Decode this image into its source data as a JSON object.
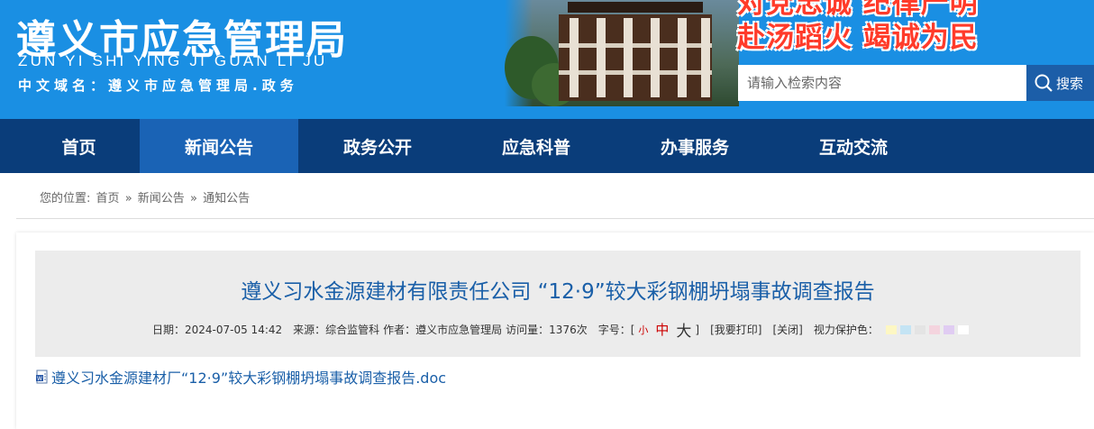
{
  "header": {
    "title": "遵义市应急管理局",
    "pinyin": "ZUN YI SHI YING JI GUAN LI JU",
    "domain": "中文域名：遵义市应急管理局.政务",
    "slogan_line1": "对党忠诚 纪律严明",
    "slogan_line2": "赴汤蹈火 竭诚为民"
  },
  "search": {
    "placeholder": "请输入检索内容",
    "button_label": "搜索"
  },
  "nav": {
    "items": [
      {
        "label": "首页"
      },
      {
        "label": "新闻公告"
      },
      {
        "label": "政务公开"
      },
      {
        "label": "应急科普"
      },
      {
        "label": "办事服务"
      },
      {
        "label": "互动交流"
      }
    ],
    "active_index": 1
  },
  "breadcrumb": {
    "prefix": "您的位置:",
    "items": [
      "首页",
      "新闻公告",
      "通知公告"
    ],
    "separator": "»"
  },
  "article": {
    "title": "遵义习水金源建材有限责任公司 “12·9”较大彩钢棚坍塌事故调查报告",
    "date": "日期：2024-07-05 14:42",
    "source": "来源：综合监管科",
    "author": "作者：遵义市应急管理局",
    "views": "访问量：1376次",
    "fontsize_label": "字号：[",
    "fs_small": "小",
    "fs_mid": "中",
    "fs_big": "大",
    "fontsize_close": "]",
    "print": "[我要打印]",
    "close": "[关闭]",
    "eye_care_label": "视力保护色：",
    "eye_care_colors": [
      "#fdf7c3",
      "#c4e4f4",
      "#e4e4e4",
      "#f4d4de",
      "#e0ccf2",
      "#ffffff"
    ],
    "attachment": "遵义习水金源建材厂“12·9”较大彩钢棚坍塌事故调查报告.doc"
  },
  "colors": {
    "banner": "#1a8fe3",
    "nav": "#0a3d7a",
    "nav_active": "#1a63b5",
    "title": "#1a5fa8"
  }
}
